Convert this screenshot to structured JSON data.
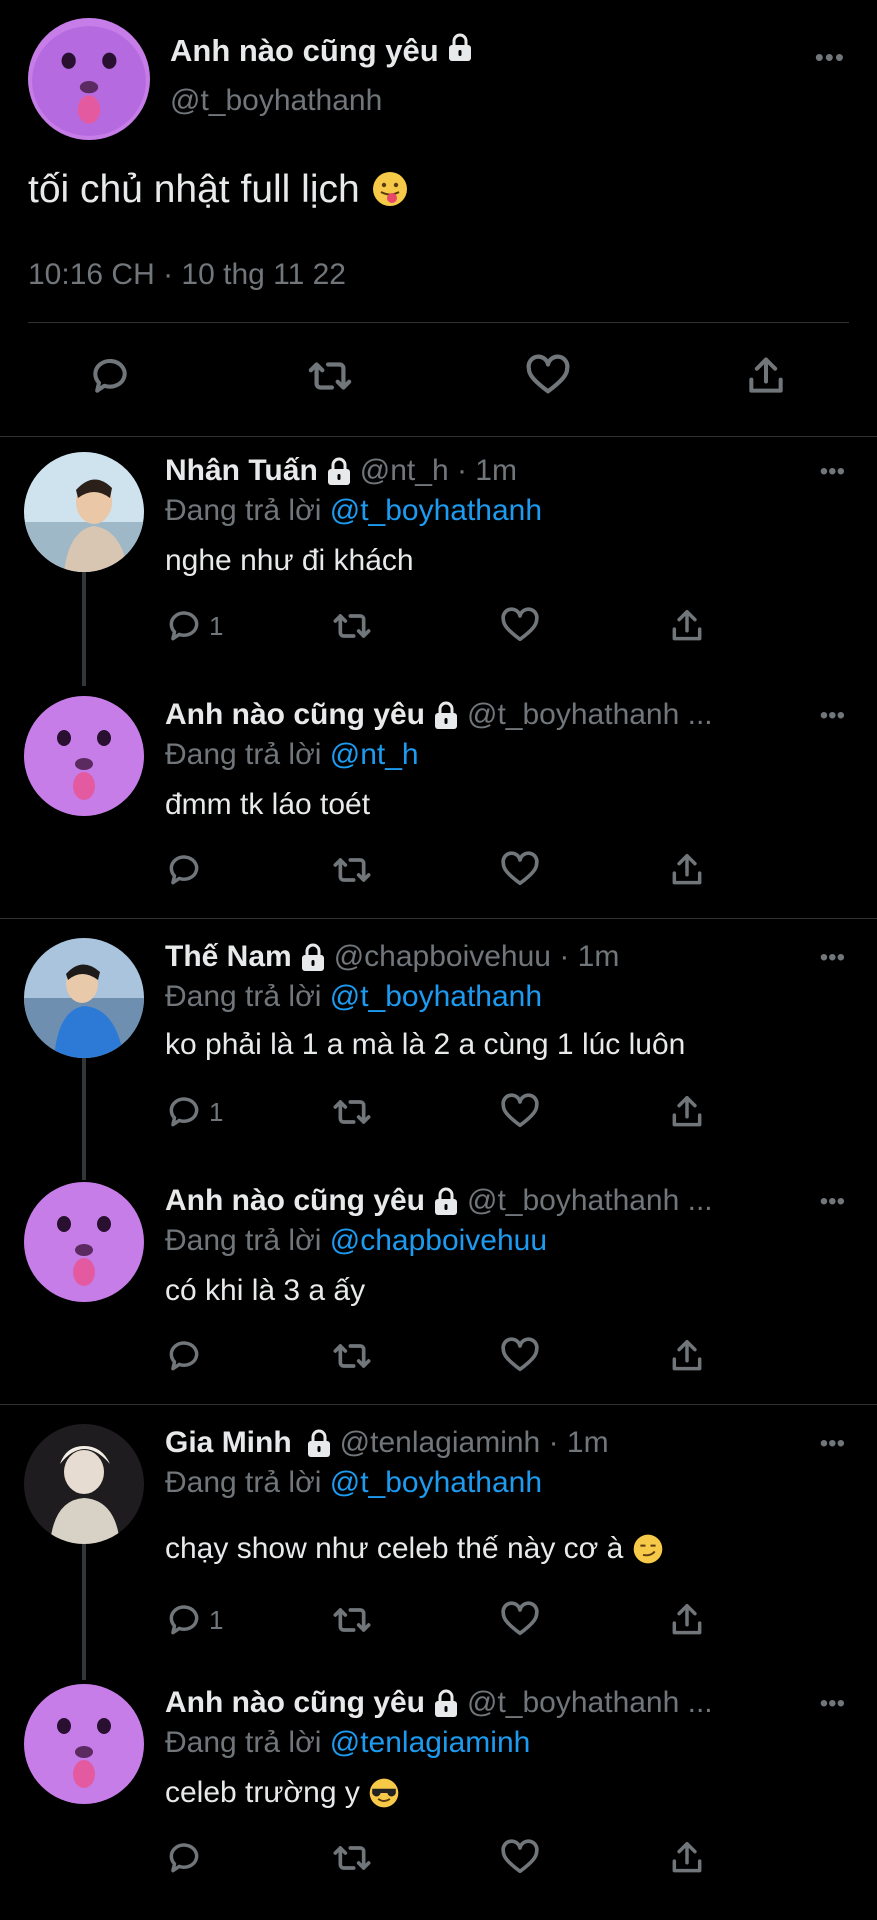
{
  "main_tweet": {
    "author_name": "Anh nào cũng yêu",
    "handle": "@t_boyhathanh",
    "text": "tối chủ nhật full lịch",
    "meta": "10:16 CH · 10 thg 11 22",
    "more_label": "•••"
  },
  "replies": [
    {
      "name": "Nhân Tuấn",
      "handle": "@nt_h · 1m",
      "replying_prefix": "Đang trả lời ",
      "replying_to": "@t_boyhathanh",
      "text": "nghe như đi khách",
      "reply_count": "1",
      "avatar": "person-photo"
    },
    {
      "name": "Anh nào cũng yêu",
      "handle": "@t_boyhathanh ...",
      "replying_prefix": "Đang trả lời ",
      "replying_to": "@nt_h",
      "text": "đmm tk láo toét",
      "reply_count": "",
      "avatar": "cat-tongue"
    },
    {
      "name": "Thế Nam",
      "handle": "@chapboivehuu · 1m",
      "replying_prefix": "Đang trả lời ",
      "replying_to": "@t_boyhathanh",
      "text": "ko phải là 1 a mà là 2 a cùng 1 lúc luôn",
      "reply_count": "1",
      "avatar": "person-sea"
    },
    {
      "name": "Anh nào cũng yêu",
      "handle": "@t_boyhathanh ...",
      "replying_prefix": "Đang trả lời ",
      "replying_to": "@chapboivehuu",
      "text": "có khi là 3 a ấy",
      "reply_count": "",
      "avatar": "cat-tongue"
    },
    {
      "name": "Gia Minh",
      "handle": "@tenlagiaminh · 1m",
      "replying_prefix": "Đang trả lời ",
      "replying_to": "@t_boyhathanh",
      "text": "chạy show như celeb thế này cơ à",
      "reply_count": "1",
      "avatar": "person-dark"
    },
    {
      "name": "Anh nào cũng yêu",
      "handle": "@t_boyhathanh ...",
      "replying_prefix": "Đang trả lời ",
      "replying_to": "@tenlagiaminh",
      "text": "celeb trường y",
      "reply_count": "",
      "avatar": "cat-tongue"
    }
  ],
  "colors": {
    "background": "#000000",
    "text": "#e7e9ea",
    "secondary": "#71767b",
    "link": "#1d9bf0",
    "divider": "#2f3336"
  }
}
